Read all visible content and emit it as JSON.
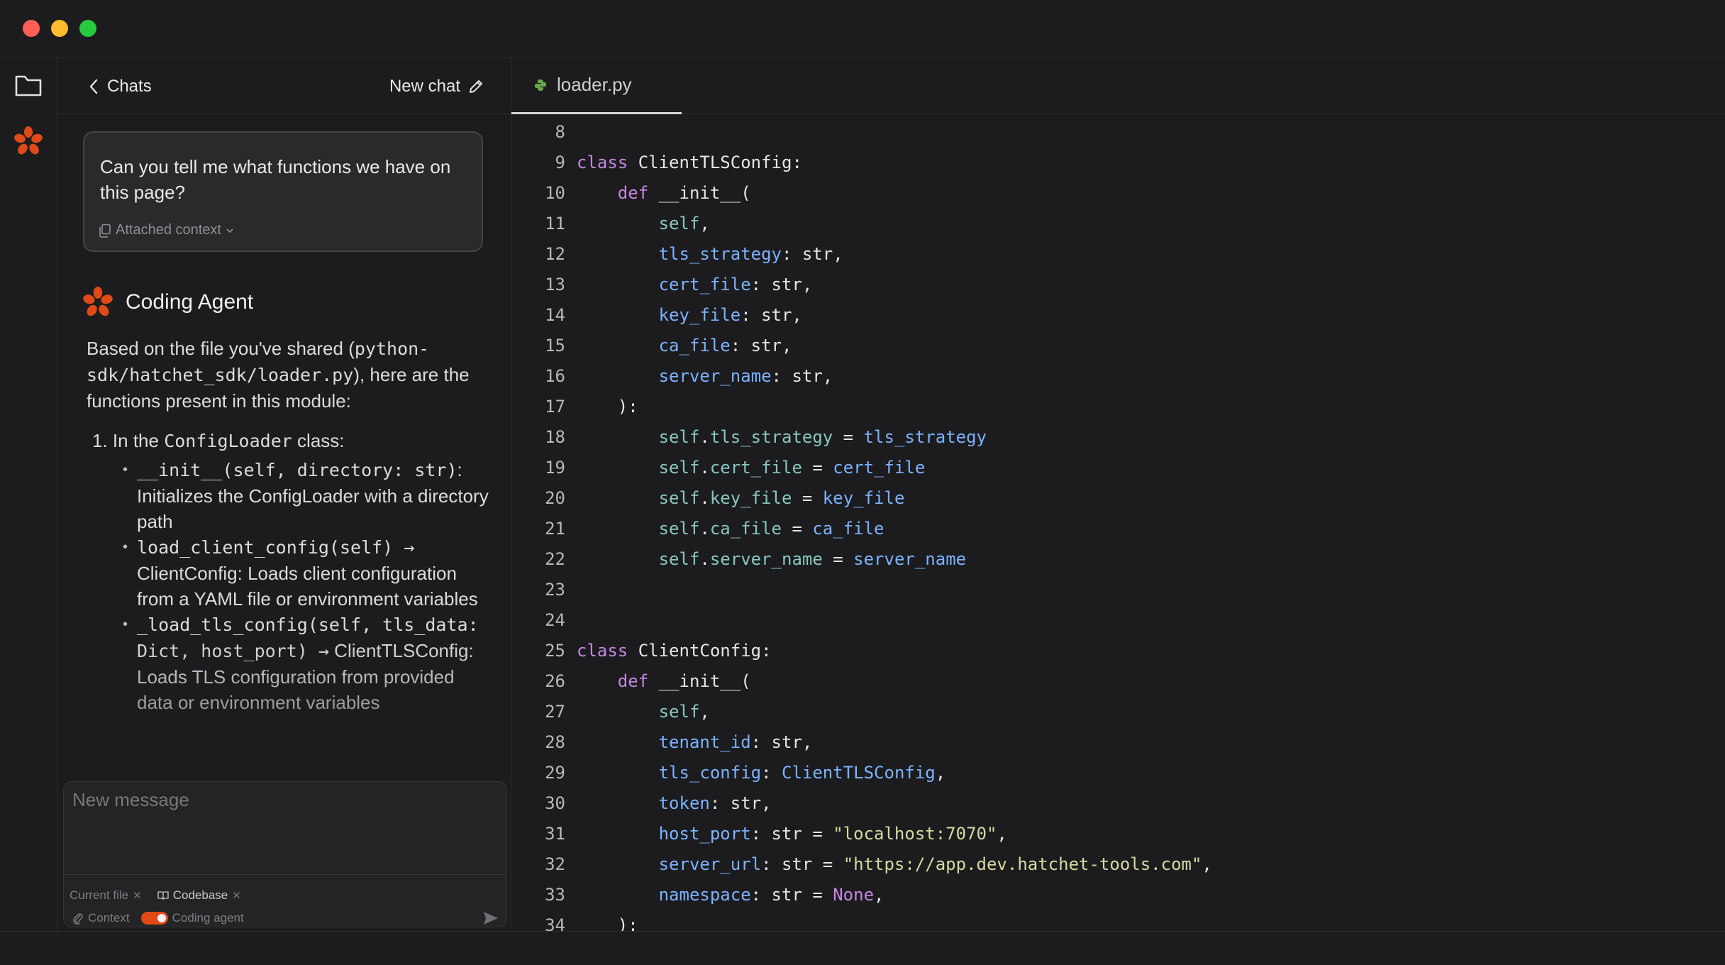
{
  "window": {
    "colors": {
      "close": "#ff5f57",
      "minimize": "#febc2e",
      "maximize": "#28c840",
      "accent": "#e04a17"
    }
  },
  "activity": {
    "folder_icon": "folder-icon",
    "logo_icon": "hatchet-logo-icon"
  },
  "chat": {
    "back_label": "Chats",
    "new_chat_label": "New chat",
    "user_message": "Can you tell me what functions we have on this page?",
    "attached_context_label": "Attached context",
    "agent_name": "Coding Agent",
    "intro_prefix": "Based on the file you've shared (",
    "intro_path": "python-sdk/hatchet_sdk/loader.py",
    "intro_suffix": "), here are the functions present in this module:",
    "list_item_1_prefix": "1. In the ",
    "list_item_1_class": "ConfigLoader",
    "list_item_1_suffix": " class:",
    "bullets": [
      {
        "code": "__init__(self, directory: str)",
        "text": ": Initializes the ConfigLoader with a directory path"
      },
      {
        "code": "load_client_config(self) →",
        "text": " ClientConfig: Loads client configuration from a YAML file or environment variables"
      },
      {
        "code": "_load_tls_config(self, tls_data: Dict, host_port) →",
        "text": " ClientTLSConfig: Loads TLS configuration from provided data or environment variables"
      }
    ]
  },
  "composer": {
    "placeholder": "New message",
    "chip_current_file": "Current file",
    "chip_codebase": "Codebase",
    "context_label": "Context",
    "coding_agent_label": "Coding agent",
    "coding_agent_enabled": true
  },
  "editor": {
    "tab_label": "loader.py",
    "lines": [
      {
        "n": "8",
        "tokens": []
      },
      {
        "n": "9",
        "tokens": [
          [
            "kw",
            "class"
          ],
          [
            "nm",
            " ClientTLSConfig:"
          ]
        ]
      },
      {
        "n": "10",
        "tokens": [
          [
            "nm",
            "    "
          ],
          [
            "kw",
            "def"
          ],
          [
            "nm",
            " __init__("
          ]
        ]
      },
      {
        "n": "11",
        "tokens": [
          [
            "nm",
            "        "
          ],
          [
            "self",
            "self"
          ],
          [
            "pun",
            ","
          ]
        ]
      },
      {
        "n": "12",
        "tokens": [
          [
            "nm",
            "        "
          ],
          [
            "pr",
            "tls_strategy"
          ],
          [
            "pun",
            ": str,"
          ]
        ]
      },
      {
        "n": "13",
        "tokens": [
          [
            "nm",
            "        "
          ],
          [
            "pr",
            "cert_file"
          ],
          [
            "pun",
            ": str,"
          ]
        ]
      },
      {
        "n": "14",
        "tokens": [
          [
            "nm",
            "        "
          ],
          [
            "pr",
            "key_file"
          ],
          [
            "pun",
            ": str,"
          ]
        ]
      },
      {
        "n": "15",
        "tokens": [
          [
            "nm",
            "        "
          ],
          [
            "pr",
            "ca_file"
          ],
          [
            "pun",
            ": str,"
          ]
        ]
      },
      {
        "n": "16",
        "tokens": [
          [
            "nm",
            "        "
          ],
          [
            "pr",
            "server_name"
          ],
          [
            "pun",
            ": str,"
          ]
        ]
      },
      {
        "n": "17",
        "tokens": [
          [
            "nm",
            "    ):"
          ]
        ]
      },
      {
        "n": "18",
        "tokens": [
          [
            "nm",
            "        "
          ],
          [
            "self",
            "self"
          ],
          [
            "pun",
            "."
          ],
          [
            "self",
            "tls_strategy"
          ],
          [
            "pun",
            " = "
          ],
          [
            "pr",
            "tls_strategy"
          ]
        ]
      },
      {
        "n": "19",
        "tokens": [
          [
            "nm",
            "        "
          ],
          [
            "self",
            "self"
          ],
          [
            "pun",
            "."
          ],
          [
            "self",
            "cert_file"
          ],
          [
            "pun",
            " = "
          ],
          [
            "pr",
            "cert_file"
          ]
        ]
      },
      {
        "n": "20",
        "tokens": [
          [
            "nm",
            "        "
          ],
          [
            "self",
            "self"
          ],
          [
            "pun",
            "."
          ],
          [
            "self",
            "key_file"
          ],
          [
            "pun",
            " = "
          ],
          [
            "pr",
            "key_file"
          ]
        ]
      },
      {
        "n": "21",
        "tokens": [
          [
            "nm",
            "        "
          ],
          [
            "self",
            "self"
          ],
          [
            "pun",
            "."
          ],
          [
            "self",
            "ca_file"
          ],
          [
            "pun",
            " = "
          ],
          [
            "pr",
            "ca_file"
          ]
        ]
      },
      {
        "n": "22",
        "tokens": [
          [
            "nm",
            "        "
          ],
          [
            "self",
            "self"
          ],
          [
            "pun",
            "."
          ],
          [
            "self",
            "server_name"
          ],
          [
            "pun",
            " = "
          ],
          [
            "pr",
            "server_name"
          ]
        ]
      },
      {
        "n": "23",
        "tokens": []
      },
      {
        "n": "24",
        "tokens": []
      },
      {
        "n": "25",
        "tokens": [
          [
            "kw",
            "class"
          ],
          [
            "nm",
            " ClientConfig:"
          ]
        ]
      },
      {
        "n": "26",
        "tokens": [
          [
            "nm",
            "    "
          ],
          [
            "kw",
            "def"
          ],
          [
            "nm",
            " __init__("
          ]
        ]
      },
      {
        "n": "27",
        "tokens": [
          [
            "nm",
            "        "
          ],
          [
            "self",
            "self"
          ],
          [
            "pun",
            ","
          ]
        ]
      },
      {
        "n": "28",
        "tokens": [
          [
            "nm",
            "        "
          ],
          [
            "pr",
            "tenant_id"
          ],
          [
            "pun",
            ": str,"
          ]
        ]
      },
      {
        "n": "29",
        "tokens": [
          [
            "nm",
            "        "
          ],
          [
            "pr",
            "tls_config"
          ],
          [
            "pun",
            ": "
          ],
          [
            "pr",
            "ClientTLSConfig"
          ],
          [
            "pun",
            ","
          ]
        ]
      },
      {
        "n": "30",
        "tokens": [
          [
            "nm",
            "        "
          ],
          [
            "pr",
            "token"
          ],
          [
            "pun",
            ": str,"
          ]
        ]
      },
      {
        "n": "31",
        "tokens": [
          [
            "nm",
            "        "
          ],
          [
            "pr",
            "host_port"
          ],
          [
            "pun",
            ": str = "
          ],
          [
            "str",
            "\"localhost:7070\""
          ],
          [
            "pun",
            ","
          ]
        ]
      },
      {
        "n": "32",
        "tokens": [
          [
            "nm",
            "        "
          ],
          [
            "pr",
            "server_url"
          ],
          [
            "pun",
            ": str = "
          ],
          [
            "str",
            "\"https://app.dev.hatchet-tools.com\""
          ],
          [
            "pun",
            ","
          ]
        ]
      },
      {
        "n": "33",
        "tokens": [
          [
            "nm",
            "        "
          ],
          [
            "pr",
            "namespace"
          ],
          [
            "pun",
            ": str = "
          ],
          [
            "none",
            "None"
          ],
          [
            "pun",
            ","
          ]
        ]
      },
      {
        "n": "34",
        "tokens": [
          [
            "nm",
            "    ):"
          ]
        ]
      }
    ]
  }
}
